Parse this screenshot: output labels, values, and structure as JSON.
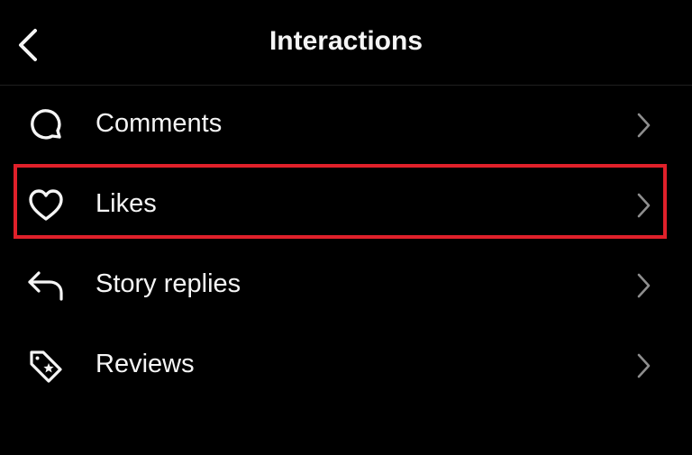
{
  "header": {
    "title": "Interactions"
  },
  "items": [
    {
      "label": "Comments",
      "icon": "comment-icon"
    },
    {
      "label": "Likes",
      "icon": "heart-icon"
    },
    {
      "label": "Story replies",
      "icon": "reply-icon"
    },
    {
      "label": "Reviews",
      "icon": "tag-star-icon"
    }
  ],
  "colors": {
    "background": "#000000",
    "text": "#f5f5f5",
    "chevron": "#8e8e8e",
    "highlight": "#e0202a"
  }
}
